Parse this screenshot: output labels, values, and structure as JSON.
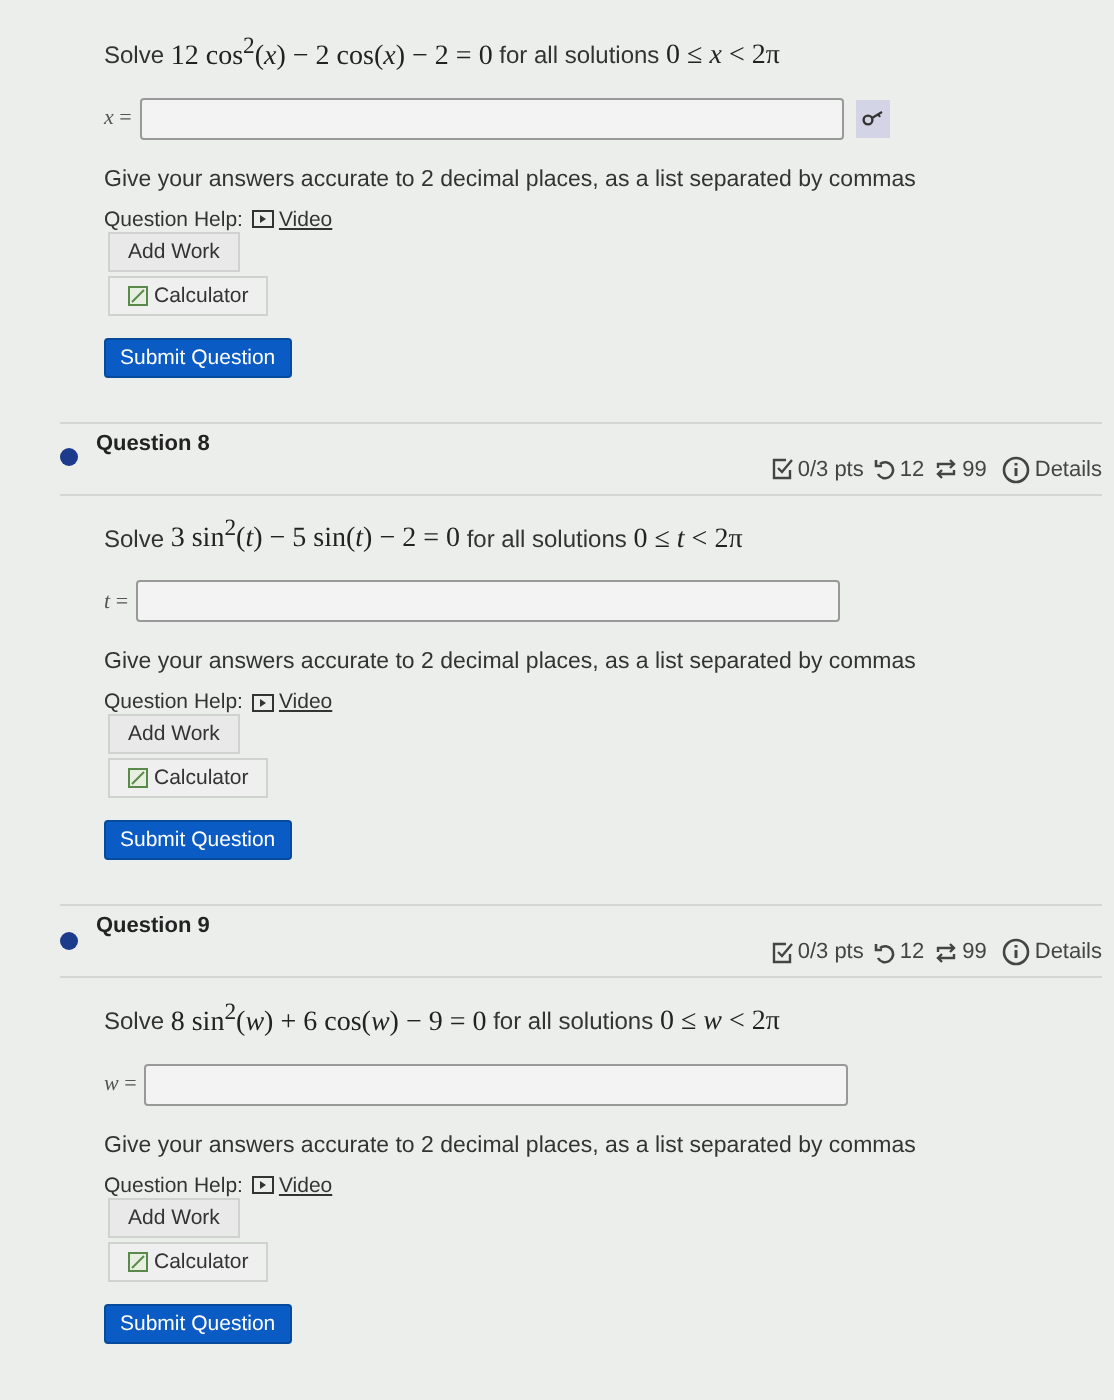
{
  "questions": [
    {
      "prompt": {
        "lead": "Solve",
        "equation": "12 cos$^{2}$(*x*) − 2 cos(*x*) − 2 = 0",
        "middle": "for all solutions",
        "range": "0 ≤ *x* < 2π"
      },
      "answer_label": "*x* =",
      "preview_button": true,
      "instruction": "Give your answers accurate to 2 decimal places, as a list separated by commas",
      "help_label": "Question Help:",
      "help_link": "Video",
      "buttons": [
        "Add Work",
        "Calculator",
        "Submit Question"
      ]
    },
    {
      "header": {
        "title": "Question 8",
        "points": "0/3 pts",
        "retries": "12",
        "attempts": "99",
        "details": "Details"
      },
      "prompt": {
        "lead": "Solve",
        "equation": "3 sin$^{2}$(*t*) − 5 sin(*t*) − 2 = 0",
        "middle": "for all solutions",
        "range": "0 ≤ *t* < 2π"
      },
      "answer_label": "*t* =",
      "preview_button": false,
      "instruction": "Give your answers accurate to 2 decimal places, as a list separated by commas",
      "help_label": "Question Help:",
      "help_link": "Video",
      "buttons": [
        "Add Work",
        "Calculator",
        "Submit Question"
      ]
    },
    {
      "header": {
        "title": "Question 9",
        "points": "0/3 pts",
        "retries": "12",
        "attempts": "99",
        "details": "Details"
      },
      "prompt": {
        "lead": "Solve",
        "equation": "8 sin$^{2}$(*w*) + 6 cos(*w*) − 9 = 0",
        "middle": "for all solutions",
        "range": "0 ≤ *w* < 2π"
      },
      "answer_label": "*w* =",
      "preview_button": false,
      "instruction": "Give your answers accurate to 2 decimal places, as a list separated by commas",
      "help_label": "Question Help:",
      "help_link": "Video",
      "buttons": [
        "Add Work",
        "Calculator",
        "Submit Question"
      ]
    }
  ]
}
